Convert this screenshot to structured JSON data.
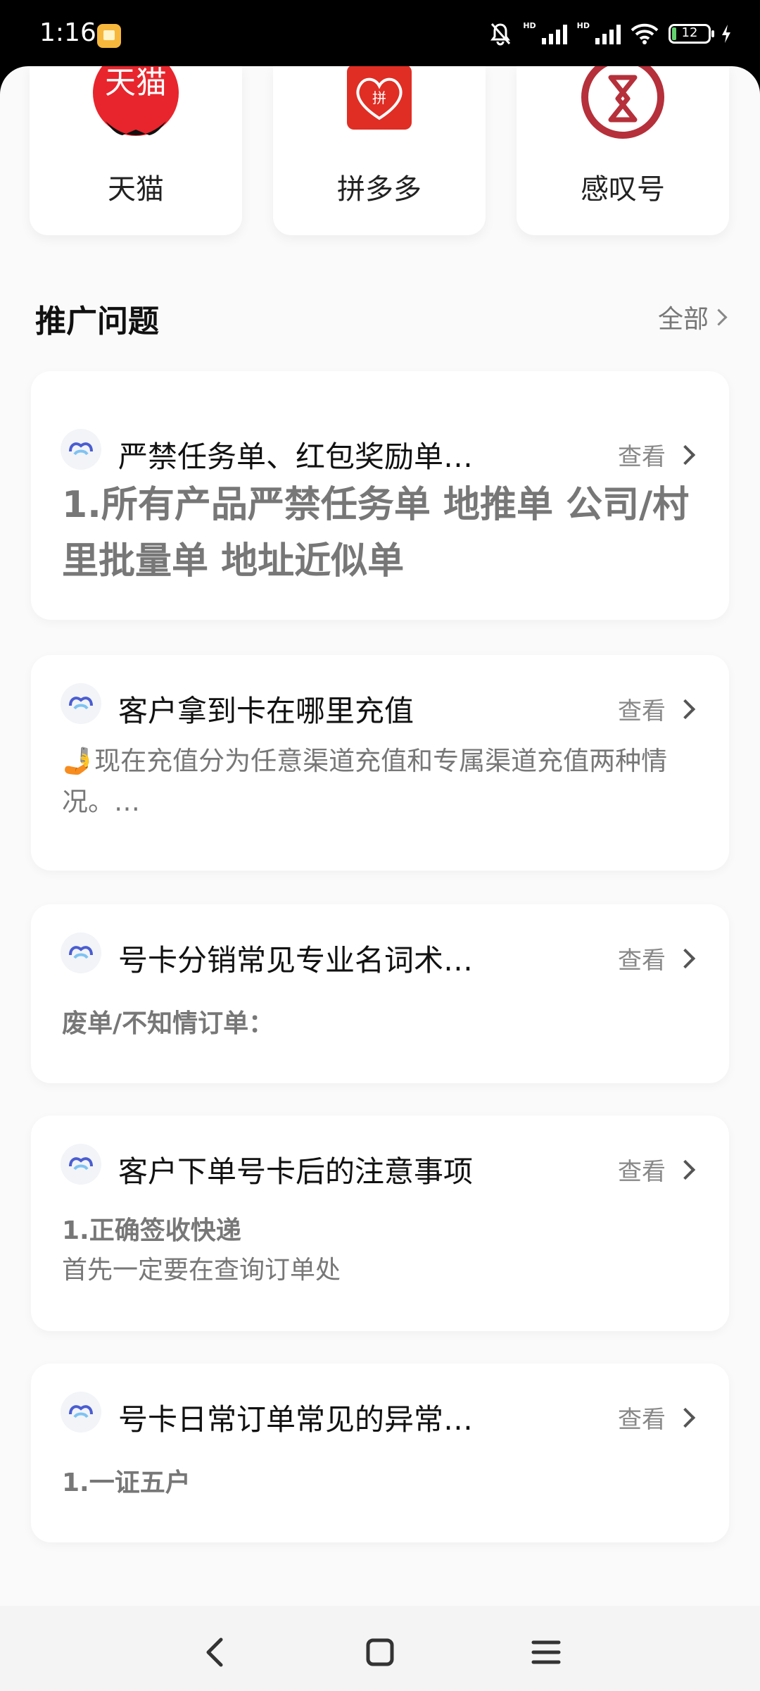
{
  "status_bar": {
    "time": "1:16",
    "battery": "12",
    "network": "HD"
  },
  "platforms": [
    {
      "name": "天猫",
      "logo_text": "天猫",
      "color": "#e8252c"
    },
    {
      "name": "拼多多",
      "logo_text": "拼",
      "color": "#e02e24"
    },
    {
      "name": "感叹号",
      "color": "#b5303a"
    }
  ],
  "section": {
    "title": "推广问题",
    "all_label": "全部"
  },
  "view_label": "查看",
  "questions": [
    {
      "title": "严禁任务单、红包奖励单…",
      "body": "1.所有产品严禁任务单 地推单 公司/村里批量单 地址近似单"
    },
    {
      "title": "客户拿到卡在哪里充值",
      "body": "🤳现在充值分为任意渠道充值和专属渠道充值两种情况。…"
    },
    {
      "title": "号卡分销常见专业名词术…",
      "body": "废单/不知情订单："
    },
    {
      "title": "客户下单号卡后的注意事项",
      "body_line1": "1.正确签收快递",
      "body_line2": "首先一定要在查询订单处"
    },
    {
      "title": "号卡日常订单常见的异常…",
      "body": "1.一证五户"
    }
  ]
}
